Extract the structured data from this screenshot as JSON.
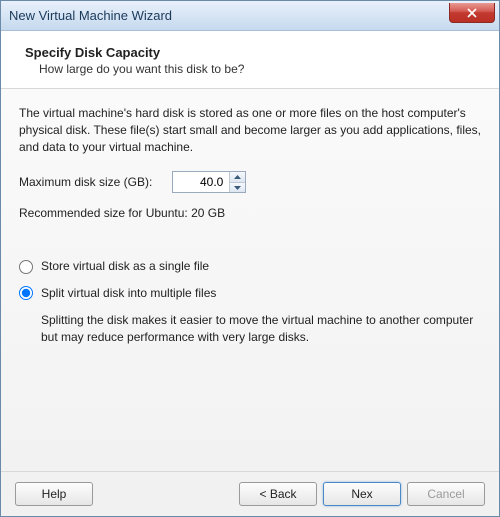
{
  "window": {
    "title": "New Virtual Machine Wizard"
  },
  "header": {
    "title": "Specify Disk Capacity",
    "subtitle": "How large do you want this disk to be?"
  },
  "content": {
    "description": "The virtual machine's hard disk is stored as one or more files on the host computer's physical disk. These file(s) start small and become larger as you add applications, files, and data to your virtual machine.",
    "size_label": "Maximum disk size (GB):",
    "size_value": "40.0",
    "recommended": "Recommended size for Ubuntu: 20 GB",
    "radio_single": "Store virtual disk as a single file",
    "radio_split": "Split virtual disk into multiple files",
    "split_desc": "Splitting the disk makes it easier to move the virtual machine to another computer but may reduce performance with very large disks."
  },
  "buttons": {
    "help": "Help",
    "back": "< Back",
    "next": "Nex",
    "cancel": "Cancel"
  },
  "selected_option": "split"
}
